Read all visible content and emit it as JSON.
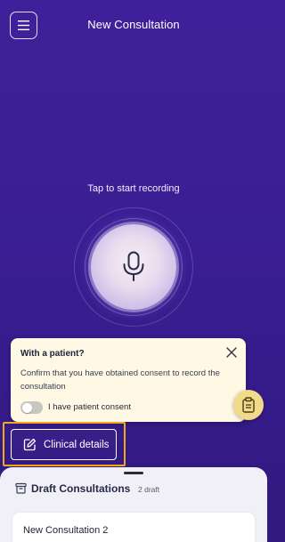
{
  "header": {
    "title": "New Consultation",
    "menu_icon": "hamburger-menu-icon"
  },
  "recorder": {
    "hint": "Tap to start recording",
    "icon": "microphone-icon"
  },
  "consent_card": {
    "title": "With a patient?",
    "message": "Confirm that you have obtained consent to record the consultation",
    "toggle_label": "I have patient consent",
    "toggle_on": false,
    "close_icon": "close-icon"
  },
  "clinical_details": {
    "label": "Clinical details",
    "icon": "edit-icon"
  },
  "fab": {
    "icon": "clipboard-icon"
  },
  "drafts": {
    "title": "Draft Consultations",
    "count": "2 draft",
    "icon": "archive-box-icon",
    "items": [
      {
        "name": "New Consultation 2"
      }
    ]
  },
  "colors": {
    "background": "#3a1e93",
    "card": "#fef8e4",
    "highlight": "#f2a81d",
    "fab": "#f3d98a",
    "sheet": "#f0f0f6"
  }
}
